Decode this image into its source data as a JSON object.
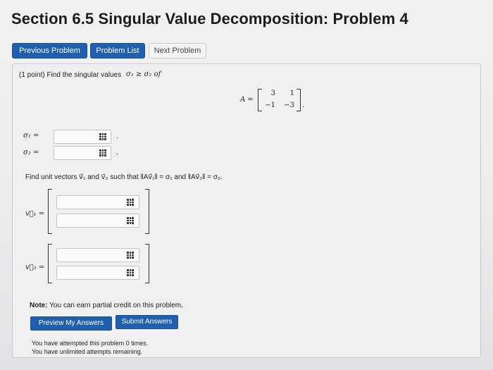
{
  "title": "Section 6.5 Singular Value Decomposition: Problem 4",
  "nav": {
    "previous": "Previous Problem",
    "list": "Problem List",
    "next": "Next Problem"
  },
  "problem": {
    "prompt": "(1 point) Find the singular values",
    "sigma_relation": "σ₁ ≥ σ₂ of",
    "matrix_label": "A =",
    "matrix": [
      [
        "3",
        "1"
      ],
      [
        "−1",
        "−3"
      ]
    ],
    "sigma1_label": "σ₁ =",
    "sigma2_label": "σ₂ =",
    "sigma1_value": "",
    "sigma2_value": "",
    "unit_vectors_prompt": "Find unit vectors v⃗₁ and v⃗₂ such that ‖Av⃗₁‖ = σ₁ and ‖Av⃗₂‖ = σ₂.",
    "v1_label": "v⃗₁ =",
    "v2_label": "v⃗₂ ="
  },
  "note": {
    "label": "Note:",
    "text": "You can earn partial credit on this problem."
  },
  "actions": {
    "preview": "Preview My Answers",
    "submit": "Submit Answers"
  },
  "status": {
    "attempted": "You have attempted this problem 0 times.",
    "remaining": "You have unlimited attempts remaining."
  }
}
